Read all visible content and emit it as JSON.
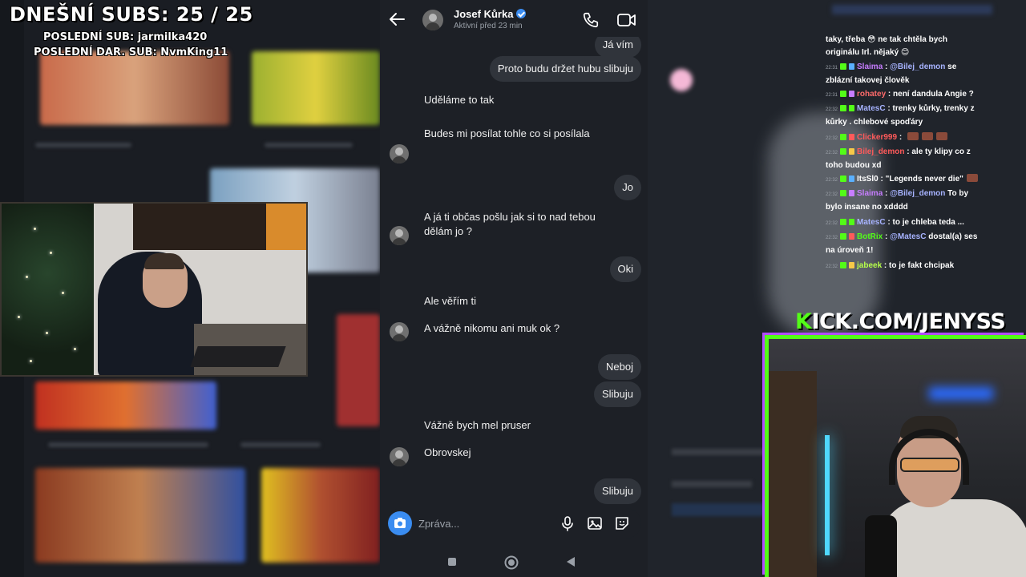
{
  "overlay": {
    "subs_title": "DNEŠNÍ SUBS: 25 / 25",
    "last_sub": "POSLEDNÍ SUB: jarmilka420",
    "last_gift_sub": "POSLEDNÍ DAR. SUB: NvmKing11",
    "kick_prefix": "K",
    "kick_rest": "ICK.COM/JENYSS"
  },
  "phone": {
    "contact_name": "Josef Kůrka",
    "contact_status": "Aktivní před 23 min",
    "icons": {
      "back": "arrow-left-icon",
      "call": "phone-icon",
      "video": "video-camera-icon"
    },
    "messages": [
      {
        "dir": "out",
        "text": "Já vím"
      },
      {
        "dir": "out",
        "text": "Proto budu držet hubu slibuju"
      },
      {
        "dir": "in",
        "text": "Uděláme to tak"
      },
      {
        "dir": "in",
        "text": "Budes mi posílat tohle co si posílala"
      },
      {
        "dir": "out",
        "text": "Jo"
      },
      {
        "dir": "in",
        "text": "A já ti občas pošlu jak si to nad tebou dělám jo ?"
      },
      {
        "dir": "out",
        "text": "Oki"
      },
      {
        "dir": "in",
        "text": "Ale věřím ti"
      },
      {
        "dir": "in",
        "text": "A vážně nikomu ani muk ok ?"
      },
      {
        "dir": "out",
        "text": "Neboj"
      },
      {
        "dir": "out",
        "text": "Slibuju"
      },
      {
        "dir": "in",
        "text": "Vážně bych mel pruser"
      },
      {
        "dir": "in",
        "text": "Obrovskej"
      },
      {
        "dir": "out",
        "text": "Slibuju"
      }
    ],
    "composer_placeholder": "Zpráva..."
  },
  "chat": [
    {
      "ts": "",
      "user": "",
      "user_color": "#ffffff",
      "text": "taky, třeba 😳 ne tak chtěla bych"
    },
    {
      "ts": "",
      "user": "",
      "user_color": "#ffffff",
      "text": "originálu Irl. nějaký 😊"
    },
    {
      "ts": "22:31",
      "user": "Slaima",
      "user_color": "#c77dff",
      "mention": "@Bilej_demon",
      "text": "se zblázní takovej člověk"
    },
    {
      "ts": "22:31",
      "user": "rohatey",
      "user_color": "#ff6b6b",
      "text": "není dandula Angie ?"
    },
    {
      "ts": "22:32",
      "user": "MatesC",
      "user_color": "#a7b3ff",
      "text": "trenky kůrky, trenky z kůrky . chlebové spoďáry"
    },
    {
      "ts": "22:32",
      "user": "Clicker999",
      "user_color": "#ff5a5a",
      "text": ""
    },
    {
      "ts": "22:32",
      "user": "Bilej_demon",
      "user_color": "#ff5a5a",
      "text": "ale ty klipy co z toho budou xd"
    },
    {
      "ts": "22:32",
      "user": "ItsSl0",
      "user_color": "#ffffff",
      "text": "\"Legends never die\""
    },
    {
      "ts": "22:32",
      "user": "Slaima",
      "user_color": "#c77dff",
      "text": "To by bylo insane no xdddd",
      "mention": "@Bilej_demon"
    },
    {
      "ts": "22:32",
      "user": "MatesC",
      "user_color": "#a7b3ff",
      "text": "to je chleba teda ..."
    },
    {
      "ts": "22:32",
      "user": "BotRix",
      "user_color": "#53fc18",
      "mention": "@MatesC",
      "text": "dostal(a) ses na úroveň 1!"
    },
    {
      "ts": "22:32",
      "user": "jabeek",
      "user_color": "#b7ff4a",
      "text": "to je fakt chcipak"
    }
  ]
}
